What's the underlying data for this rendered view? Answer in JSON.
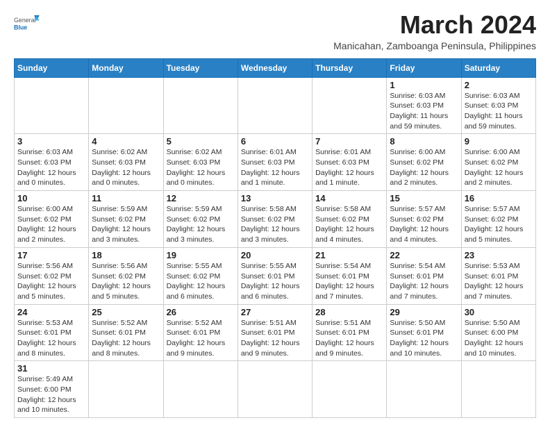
{
  "logo": {
    "text_general": "General",
    "text_blue": "Blue"
  },
  "title": "March 2024",
  "subtitle": "Manicahan, Zamboanga Peninsula, Philippines",
  "days_of_week": [
    "Sunday",
    "Monday",
    "Tuesday",
    "Wednesday",
    "Thursday",
    "Friday",
    "Saturday"
  ],
  "weeks": [
    [
      {
        "day": "",
        "info": ""
      },
      {
        "day": "",
        "info": ""
      },
      {
        "day": "",
        "info": ""
      },
      {
        "day": "",
        "info": ""
      },
      {
        "day": "",
        "info": ""
      },
      {
        "day": "1",
        "info": "Sunrise: 6:03 AM\nSunset: 6:03 PM\nDaylight: 11 hours and 59 minutes."
      },
      {
        "day": "2",
        "info": "Sunrise: 6:03 AM\nSunset: 6:03 PM\nDaylight: 11 hours and 59 minutes."
      }
    ],
    [
      {
        "day": "3",
        "info": "Sunrise: 6:03 AM\nSunset: 6:03 PM\nDaylight: 12 hours and 0 minutes."
      },
      {
        "day": "4",
        "info": "Sunrise: 6:02 AM\nSunset: 6:03 PM\nDaylight: 12 hours and 0 minutes."
      },
      {
        "day": "5",
        "info": "Sunrise: 6:02 AM\nSunset: 6:03 PM\nDaylight: 12 hours and 0 minutes."
      },
      {
        "day": "6",
        "info": "Sunrise: 6:01 AM\nSunset: 6:03 PM\nDaylight: 12 hours and 1 minute."
      },
      {
        "day": "7",
        "info": "Sunrise: 6:01 AM\nSunset: 6:03 PM\nDaylight: 12 hours and 1 minute."
      },
      {
        "day": "8",
        "info": "Sunrise: 6:00 AM\nSunset: 6:02 PM\nDaylight: 12 hours and 2 minutes."
      },
      {
        "day": "9",
        "info": "Sunrise: 6:00 AM\nSunset: 6:02 PM\nDaylight: 12 hours and 2 minutes."
      }
    ],
    [
      {
        "day": "10",
        "info": "Sunrise: 6:00 AM\nSunset: 6:02 PM\nDaylight: 12 hours and 2 minutes."
      },
      {
        "day": "11",
        "info": "Sunrise: 5:59 AM\nSunset: 6:02 PM\nDaylight: 12 hours and 3 minutes."
      },
      {
        "day": "12",
        "info": "Sunrise: 5:59 AM\nSunset: 6:02 PM\nDaylight: 12 hours and 3 minutes."
      },
      {
        "day": "13",
        "info": "Sunrise: 5:58 AM\nSunset: 6:02 PM\nDaylight: 12 hours and 3 minutes."
      },
      {
        "day": "14",
        "info": "Sunrise: 5:58 AM\nSunset: 6:02 PM\nDaylight: 12 hours and 4 minutes."
      },
      {
        "day": "15",
        "info": "Sunrise: 5:57 AM\nSunset: 6:02 PM\nDaylight: 12 hours and 4 minutes."
      },
      {
        "day": "16",
        "info": "Sunrise: 5:57 AM\nSunset: 6:02 PM\nDaylight: 12 hours and 5 minutes."
      }
    ],
    [
      {
        "day": "17",
        "info": "Sunrise: 5:56 AM\nSunset: 6:02 PM\nDaylight: 12 hours and 5 minutes."
      },
      {
        "day": "18",
        "info": "Sunrise: 5:56 AM\nSunset: 6:02 PM\nDaylight: 12 hours and 5 minutes."
      },
      {
        "day": "19",
        "info": "Sunrise: 5:55 AM\nSunset: 6:02 PM\nDaylight: 12 hours and 6 minutes."
      },
      {
        "day": "20",
        "info": "Sunrise: 5:55 AM\nSunset: 6:01 PM\nDaylight: 12 hours and 6 minutes."
      },
      {
        "day": "21",
        "info": "Sunrise: 5:54 AM\nSunset: 6:01 PM\nDaylight: 12 hours and 7 minutes."
      },
      {
        "day": "22",
        "info": "Sunrise: 5:54 AM\nSunset: 6:01 PM\nDaylight: 12 hours and 7 minutes."
      },
      {
        "day": "23",
        "info": "Sunrise: 5:53 AM\nSunset: 6:01 PM\nDaylight: 12 hours and 7 minutes."
      }
    ],
    [
      {
        "day": "24",
        "info": "Sunrise: 5:53 AM\nSunset: 6:01 PM\nDaylight: 12 hours and 8 minutes."
      },
      {
        "day": "25",
        "info": "Sunrise: 5:52 AM\nSunset: 6:01 PM\nDaylight: 12 hours and 8 minutes."
      },
      {
        "day": "26",
        "info": "Sunrise: 5:52 AM\nSunset: 6:01 PM\nDaylight: 12 hours and 9 minutes."
      },
      {
        "day": "27",
        "info": "Sunrise: 5:51 AM\nSunset: 6:01 PM\nDaylight: 12 hours and 9 minutes."
      },
      {
        "day": "28",
        "info": "Sunrise: 5:51 AM\nSunset: 6:01 PM\nDaylight: 12 hours and 9 minutes."
      },
      {
        "day": "29",
        "info": "Sunrise: 5:50 AM\nSunset: 6:01 PM\nDaylight: 12 hours and 10 minutes."
      },
      {
        "day": "30",
        "info": "Sunrise: 5:50 AM\nSunset: 6:00 PM\nDaylight: 12 hours and 10 minutes."
      }
    ],
    [
      {
        "day": "31",
        "info": "Sunrise: 5:49 AM\nSunset: 6:00 PM\nDaylight: 12 hours and 10 minutes."
      },
      {
        "day": "",
        "info": ""
      },
      {
        "day": "",
        "info": ""
      },
      {
        "day": "",
        "info": ""
      },
      {
        "day": "",
        "info": ""
      },
      {
        "day": "",
        "info": ""
      },
      {
        "day": "",
        "info": ""
      }
    ]
  ]
}
